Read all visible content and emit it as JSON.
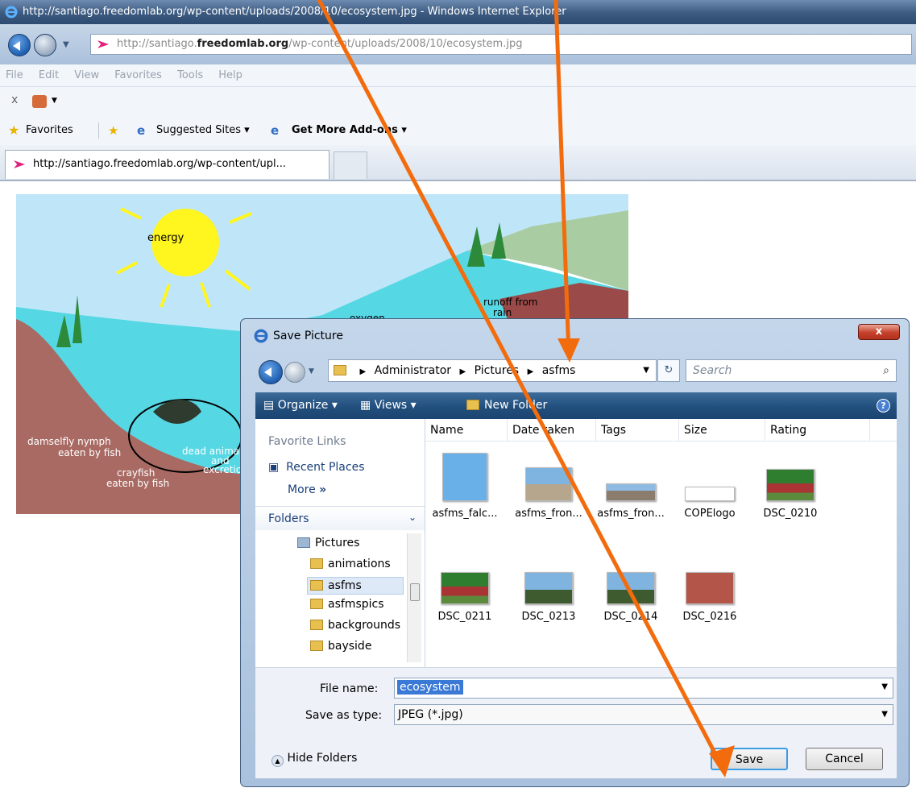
{
  "browser": {
    "title": "http://santiago.freedomlab.org/wp-content/uploads/2008/10/ecosystem.jpg - Windows Internet Explorer",
    "address_prefix": "http://santiago.",
    "address_domain": "freedomlab.org",
    "address_suffix": "/wp-content/uploads/2008/10/ecosystem.jpg",
    "menu": [
      "File",
      "Edit",
      "View",
      "Favorites",
      "Tools",
      "Help"
    ],
    "favorites_label": "Favorites",
    "suggested_sites": "Suggested Sites",
    "addons": "Get More Add-ons",
    "tab_label": "http://santiago.freedomlab.org/wp-content/upl..."
  },
  "image_labels": {
    "energy": "energy",
    "oxygen": "oxygen",
    "runoff": "runoff from",
    "runoff2": "rain",
    "damselfly": "damselfly nymph",
    "damselfly2": "eaten by fish",
    "dead": "dead animals",
    "dead2": "and",
    "dead3": "excretion",
    "crayfish": "crayfish",
    "crayfish2": "eaten by fish"
  },
  "dialog": {
    "title": "Save Picture",
    "close": "x",
    "breadcrumb": [
      "Administrator",
      "Pictures",
      "asfms"
    ],
    "search_placeholder": "Search",
    "toolbar": {
      "organize": "Organize",
      "views": "Views",
      "new_folder": "New Folder"
    },
    "favorite_links_header": "Favorite Links",
    "recent_places": "Recent Places",
    "more": "More",
    "folders_header": "Folders",
    "folders": [
      "Pictures",
      "animations",
      "asfms",
      "asfmspics",
      "backgrounds",
      "bayside"
    ],
    "columns": [
      "Name",
      "Date taken",
      "Tags",
      "Size",
      "Rating"
    ],
    "files": [
      "asfms_falc...",
      "asfms_fron...",
      "asfms_fron...",
      "COPElogo",
      "DSC_0210",
      "DSC_0211",
      "DSC_0213",
      "DSC_0214",
      "DSC_0216"
    ],
    "file_name_label": "File name:",
    "file_name_value": "ecosystem",
    "save_type_label": "Save as type:",
    "save_type_value": "JPEG (*.jpg)",
    "hide_folders": "Hide Folders",
    "save": "Save",
    "cancel": "Cancel"
  },
  "colors": {
    "annotation_arrow": "#f26c0d",
    "dialog_frame": "#b4c9e3",
    "toolbar": "#24527f"
  }
}
